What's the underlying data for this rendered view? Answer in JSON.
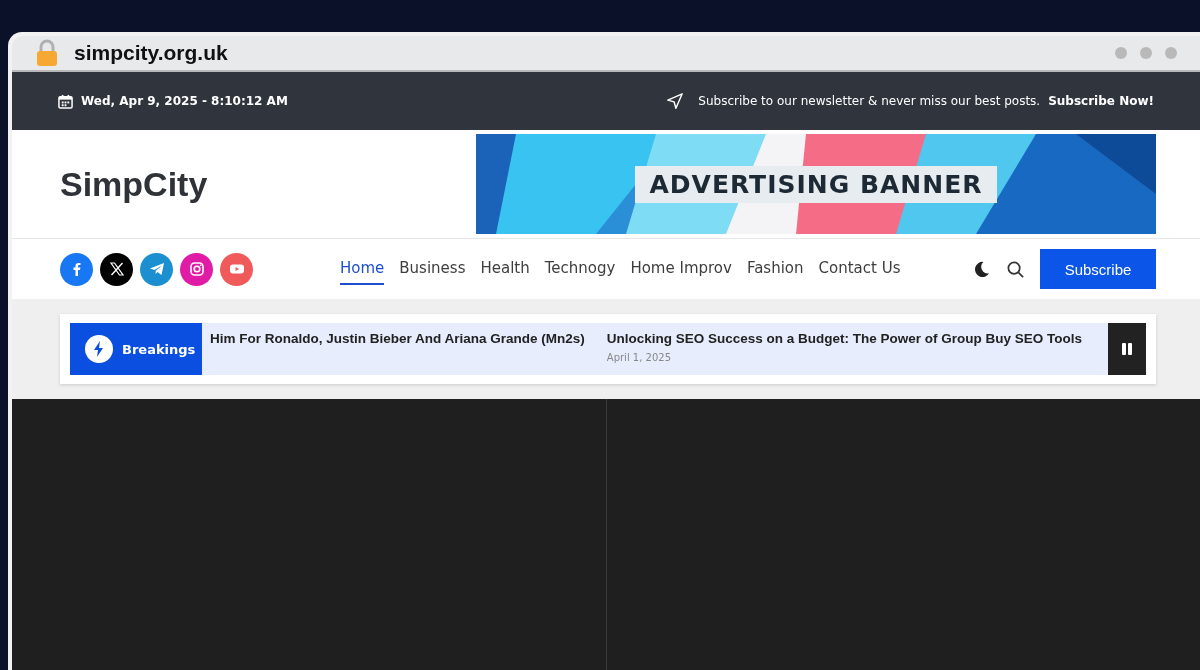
{
  "browser": {
    "address": "simpcity.org.uk"
  },
  "topbar": {
    "datetime": "Wed, Apr 9, 2025 - 8:10:12 AM",
    "newsletter_text": "Subscribe to our newsletter & never miss our best posts.",
    "newsletter_link": "Subscribe Now!"
  },
  "header": {
    "site_title": "SimpCity",
    "banner_text": "ADVERTISING BANNER"
  },
  "social": [
    {
      "kind": "facebook",
      "color": "#1877f2"
    },
    {
      "kind": "x",
      "color": "#000000"
    },
    {
      "kind": "telegram",
      "color": "#1c8fd0"
    },
    {
      "kind": "instagram",
      "color": "#e01ca6"
    },
    {
      "kind": "youtube",
      "color": "#f05a5a"
    }
  ],
  "nav": [
    {
      "label": "Home",
      "selected": true
    },
    {
      "label": "Business",
      "selected": false
    },
    {
      "label": "Health",
      "selected": false
    },
    {
      "label": "Technogy",
      "selected": false
    },
    {
      "label": "Home Improv",
      "selected": false
    },
    {
      "label": "Fashion",
      "selected": false
    },
    {
      "label": "Contact Us",
      "selected": false
    }
  ],
  "subscribe_button": "Subscribe",
  "ticker": {
    "label": "Breakings",
    "items": [
      {
        "title": "Him For Ronaldo, Justin Bieber And Ariana Grande (Mn2s)"
      },
      {
        "title": "Unlocking SEO Success on a Budget: The Power of Group Buy SEO Tools",
        "date": "April 1, 2025"
      }
    ]
  }
}
